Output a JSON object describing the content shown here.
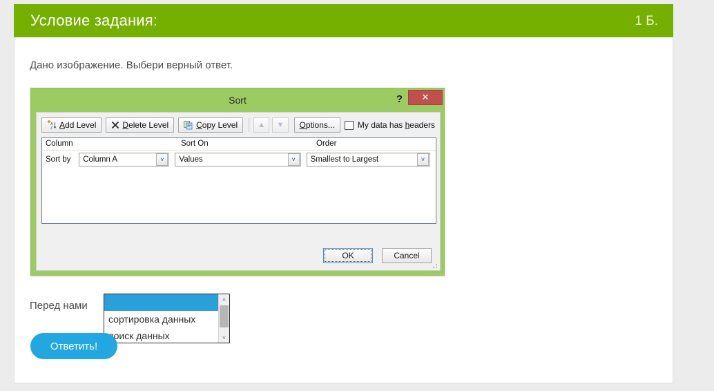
{
  "header": {
    "title": "Условие задания:",
    "score": "1 Б."
  },
  "prompt": "Дано изображение. Выбери верный ответ.",
  "sort_dialog": {
    "title": "Sort",
    "help_icon": "?",
    "close_icon": "✕",
    "toolbar": {
      "add_level": "Add Level",
      "add_level_accel": "A",
      "delete_level": "Delete Level",
      "delete_level_accel": "D",
      "copy_level": "Copy Level",
      "copy_level_accel": "C",
      "move_up_icon": "▲",
      "move_down_icon": "▼",
      "options": "Options...",
      "options_accel": "O",
      "headers_checkbox_label_pre": "My data has ",
      "headers_checkbox_accel": "h",
      "headers_checkbox_label_post": "eaders",
      "headers_checked": false
    },
    "grid": {
      "headers": [
        "Column",
        "Sort On",
        "Order"
      ],
      "row_label": "Sort by",
      "column_value": "Column A",
      "sort_on_value": "Values",
      "order_value": "Smallest to Largest",
      "dropdown_icon": "˅"
    },
    "ok": "OK",
    "cancel": "Cancel"
  },
  "answer": {
    "lead_text": "Перед нами",
    "listbox": {
      "options": [
        "",
        "сортировка данных",
        "поиск данных"
      ],
      "selected_index": 0,
      "scroll_up_icon": "˄",
      "scroll_down_icon": "˅"
    },
    "submit_label": "Ответить!"
  },
  "colors": {
    "header_green": "#75af00",
    "dialog_green": "#9ccb63",
    "close_red": "#c0504d",
    "select_blue": "#2b9fd8",
    "button_blue": "#23a7e0"
  }
}
